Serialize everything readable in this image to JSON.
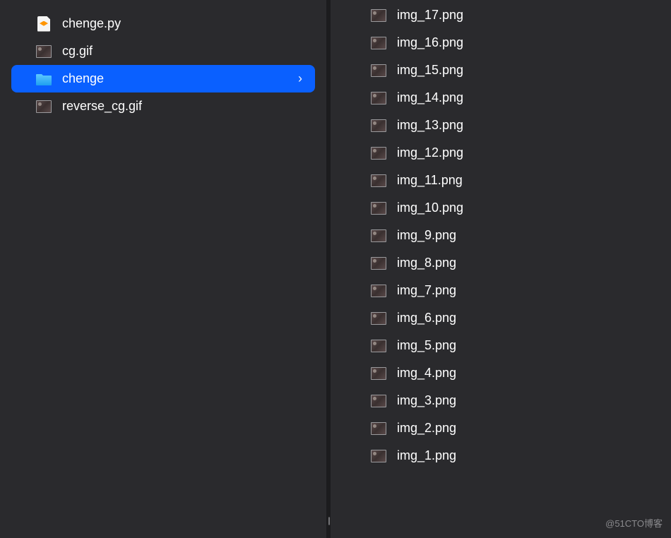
{
  "left_panel": {
    "items": [
      {
        "name": "chenge.py",
        "icon": "sublime-doc",
        "selected": false,
        "has_children": false
      },
      {
        "name": "cg.gif",
        "icon": "image-thumb",
        "selected": false,
        "has_children": false
      },
      {
        "name": "chenge",
        "icon": "folder",
        "selected": true,
        "has_children": true
      },
      {
        "name": "reverse_cg.gif",
        "icon": "image-thumb",
        "selected": false,
        "has_children": false
      }
    ]
  },
  "right_panel": {
    "items": [
      {
        "name": "img_17.png",
        "icon": "image-thumb"
      },
      {
        "name": "img_16.png",
        "icon": "image-thumb"
      },
      {
        "name": "img_15.png",
        "icon": "image-thumb"
      },
      {
        "name": "img_14.png",
        "icon": "image-thumb"
      },
      {
        "name": "img_13.png",
        "icon": "image-thumb"
      },
      {
        "name": "img_12.png",
        "icon": "image-thumb"
      },
      {
        "name": "img_11.png",
        "icon": "image-thumb"
      },
      {
        "name": "img_10.png",
        "icon": "image-thumb"
      },
      {
        "name": "img_9.png",
        "icon": "image-thumb"
      },
      {
        "name": "img_8.png",
        "icon": "image-thumb"
      },
      {
        "name": "img_7.png",
        "icon": "image-thumb"
      },
      {
        "name": "img_6.png",
        "icon": "image-thumb"
      },
      {
        "name": "img_5.png",
        "icon": "image-thumb"
      },
      {
        "name": "img_4.png",
        "icon": "image-thumb"
      },
      {
        "name": "img_3.png",
        "icon": "image-thumb"
      },
      {
        "name": "img_2.png",
        "icon": "image-thumb"
      },
      {
        "name": "img_1.png",
        "icon": "image-thumb"
      }
    ]
  },
  "watermark": "@51CTO博客",
  "chevron_glyph": "›",
  "divider_glyph": "||"
}
